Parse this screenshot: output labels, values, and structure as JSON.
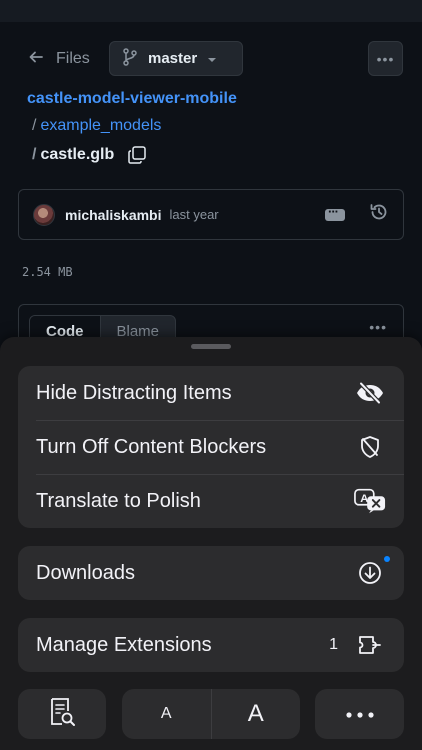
{
  "github": {
    "back_label": "Files",
    "branch": "master",
    "repo": "castle-model-viewer-mobile",
    "path_sep": "/",
    "path_folder": "example_models",
    "file_name": "castle.glb",
    "commit_author": "michaliskambi",
    "commit_time": "last year",
    "file_size": "2.54 MB",
    "tabs": [
      "Code",
      "Blame"
    ]
  },
  "menu": {
    "items": [
      {
        "label": "Hide Distracting Items",
        "icon": "eye-slash-icon"
      },
      {
        "label": "Turn Off Content Blockers",
        "icon": "shield-slash-icon"
      },
      {
        "label": "Translate to Polish",
        "icon": "translate-icon"
      }
    ],
    "downloads": {
      "label": "Downloads",
      "icon": "download-icon"
    },
    "extensions": {
      "label": "Manage Extensions",
      "count": "1",
      "icon": "extension-icon"
    }
  },
  "toolbar": {
    "font_small": "A",
    "font_large": "A"
  },
  "colors": {
    "link": "#4493f8",
    "sheet": "#1c1c1e",
    "group": "#2c2c2e",
    "accent_dot": "#0a84ff"
  }
}
